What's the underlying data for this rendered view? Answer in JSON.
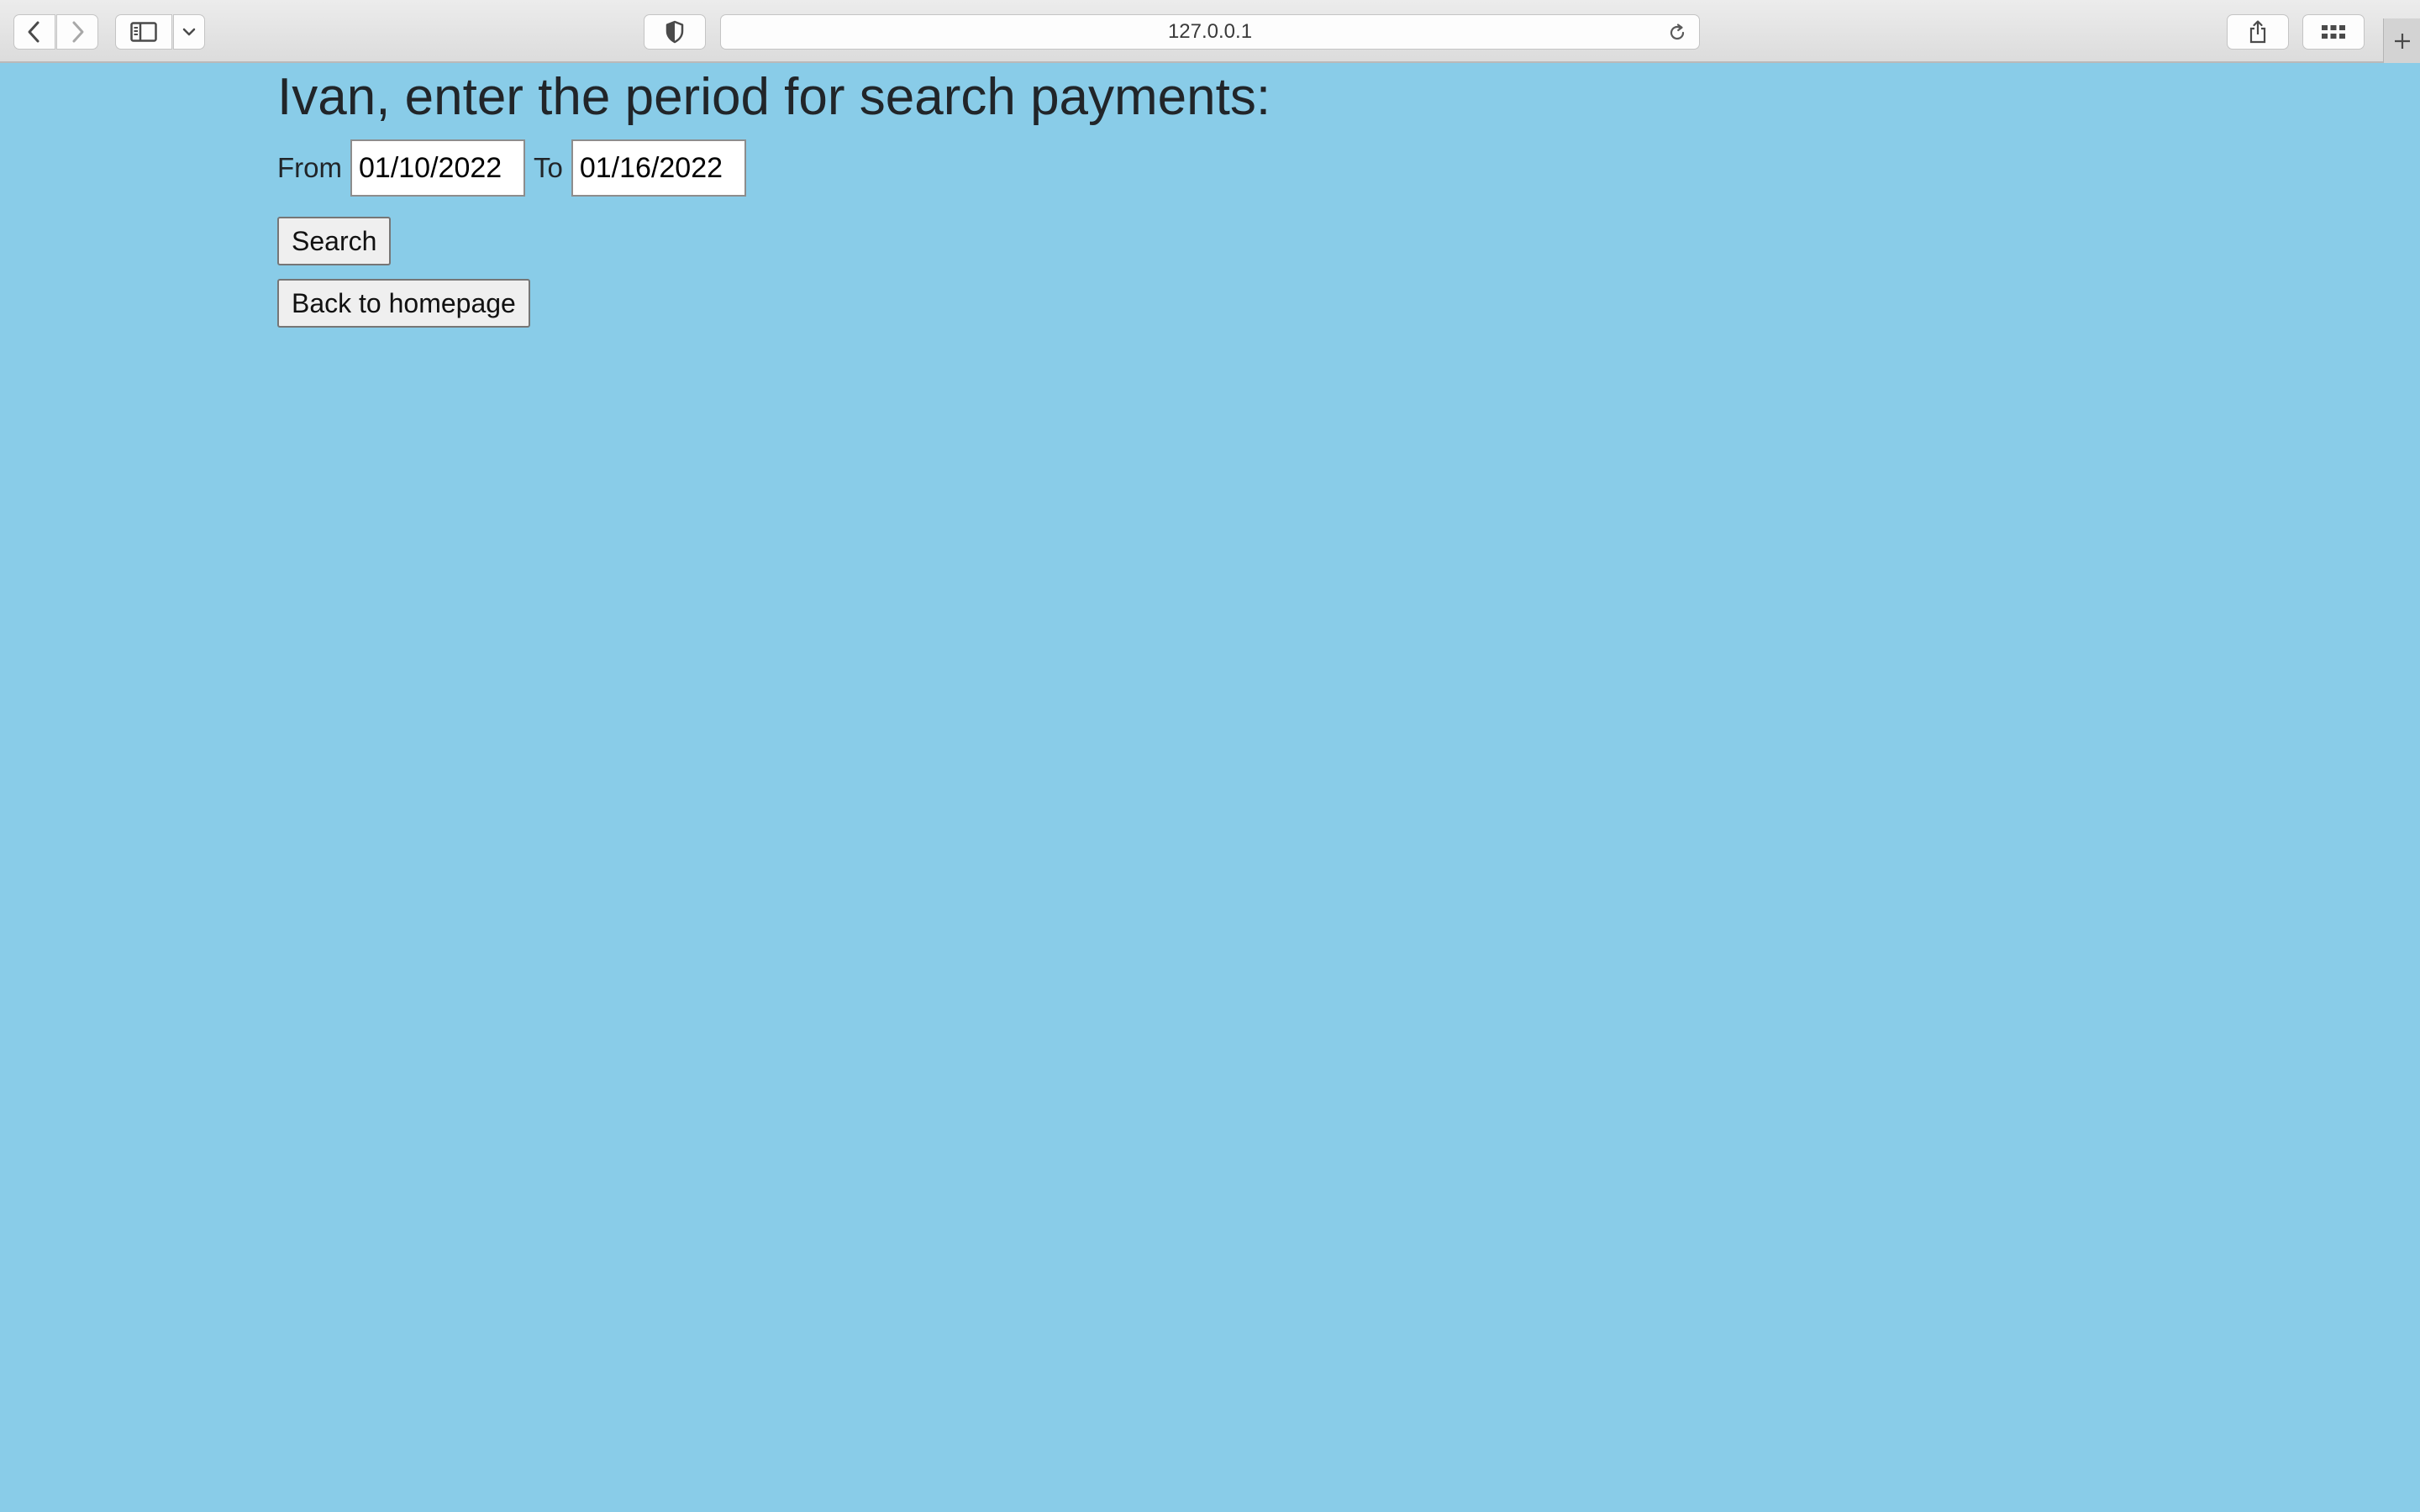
{
  "browser": {
    "url": "127.0.0.1",
    "icons": {
      "back": "chevron-left-icon",
      "forward": "chevron-right-icon",
      "sidebar": "sidebar-icon",
      "sidebar_menu": "chevron-down-icon",
      "privacy": "shield-icon",
      "reload": "reload-icon",
      "share": "share-icon",
      "tabs": "tab-overview-icon",
      "new_tab": "plus-icon"
    }
  },
  "page": {
    "background": "#89cce8",
    "title": "Ivan, enter the period for search payments:",
    "from_label": "From",
    "from_value": "01/10/2022",
    "to_label": "To",
    "to_value": "01/16/2022",
    "search_button": "Search",
    "home_button": "Back to homepage"
  }
}
